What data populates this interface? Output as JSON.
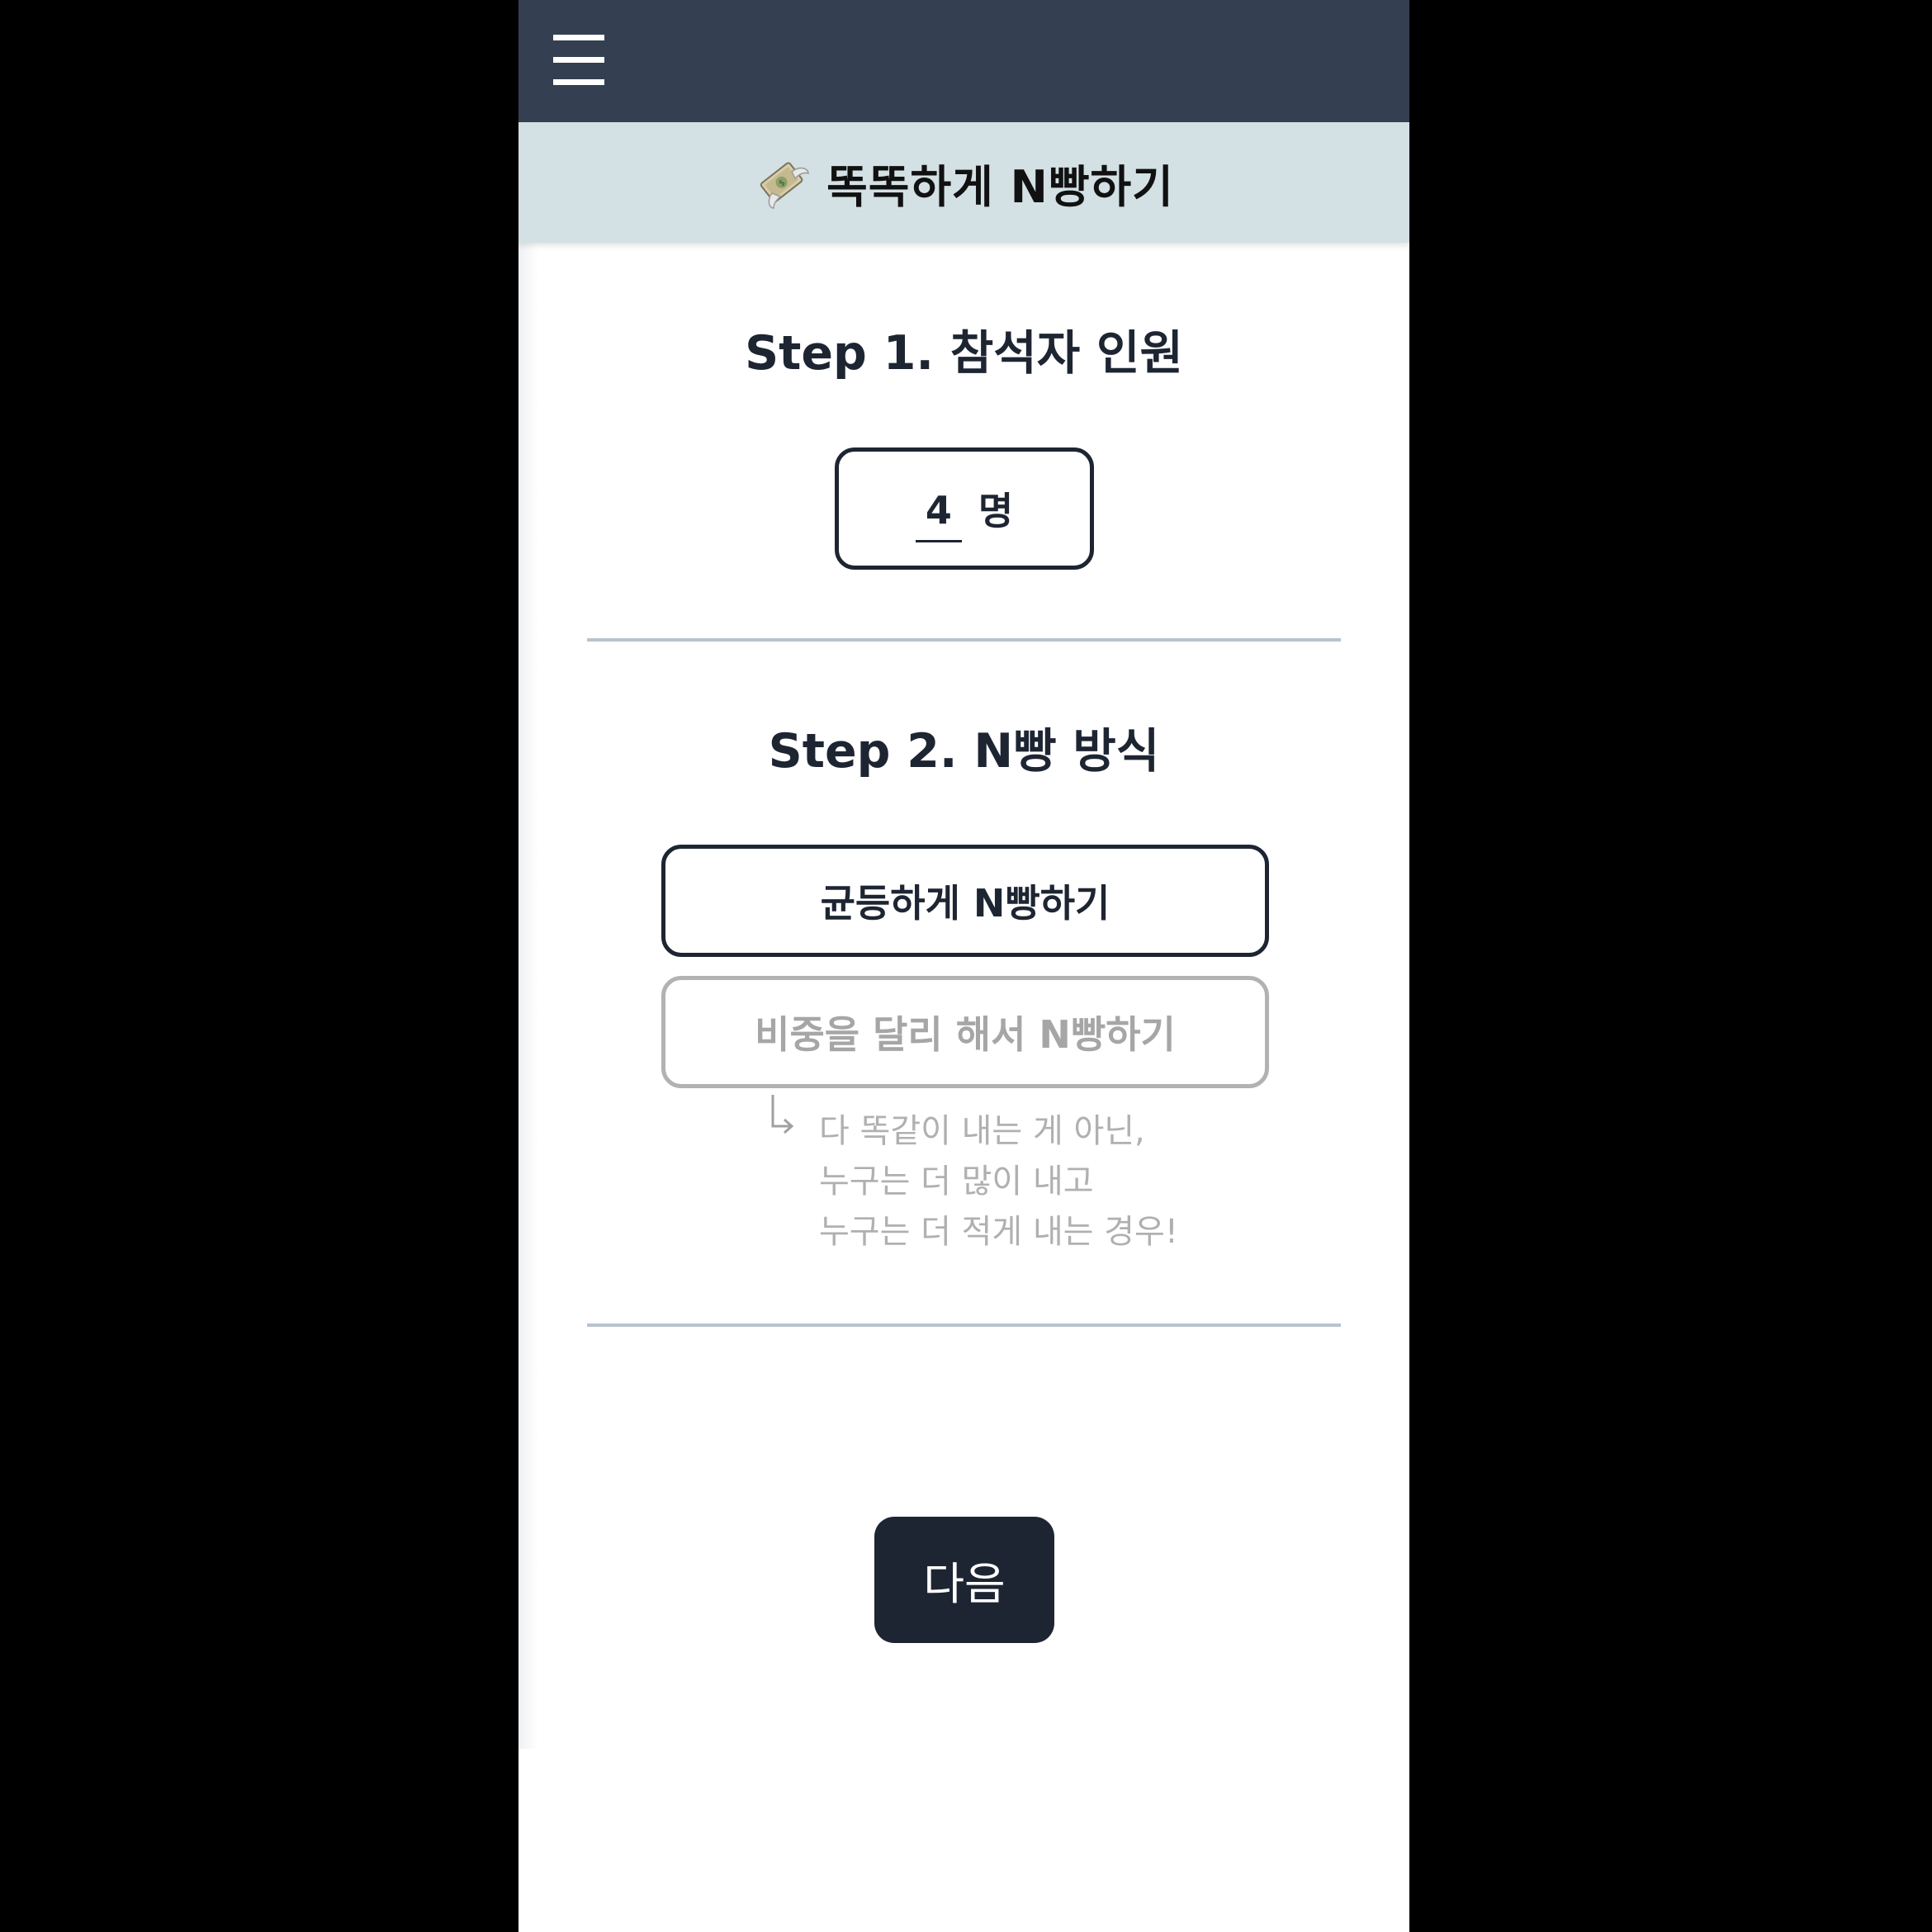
{
  "header": {
    "menu_icon": "hamburger-menu-icon",
    "app_icon": "money-with-wings-icon",
    "title": "똑똑하게 N빵하기"
  },
  "step1": {
    "title": "Step 1. 참석자 인원",
    "people_count": "4",
    "unit": "명"
  },
  "step2": {
    "title": "Step 2. N빵 방식",
    "options": [
      {
        "label": "균등하게 N빵하기",
        "selected": true
      },
      {
        "label": "비중을 달리 해서 N빵하기",
        "selected": false
      }
    ],
    "hint_icon": "return-arrow-icon",
    "hint_lines": [
      "다 똑같이 내는 게 아닌,",
      "누구는 더 많이 내고",
      "누구는 더 적게 내는 경우!"
    ]
  },
  "footer": {
    "next_label": "다음"
  },
  "colors": {
    "topbar": "#343f51",
    "titlebar": "#d3e0e4",
    "primary": "#1e2532",
    "inactive": "#a6a6a6",
    "divider": "#b8c3cf"
  }
}
